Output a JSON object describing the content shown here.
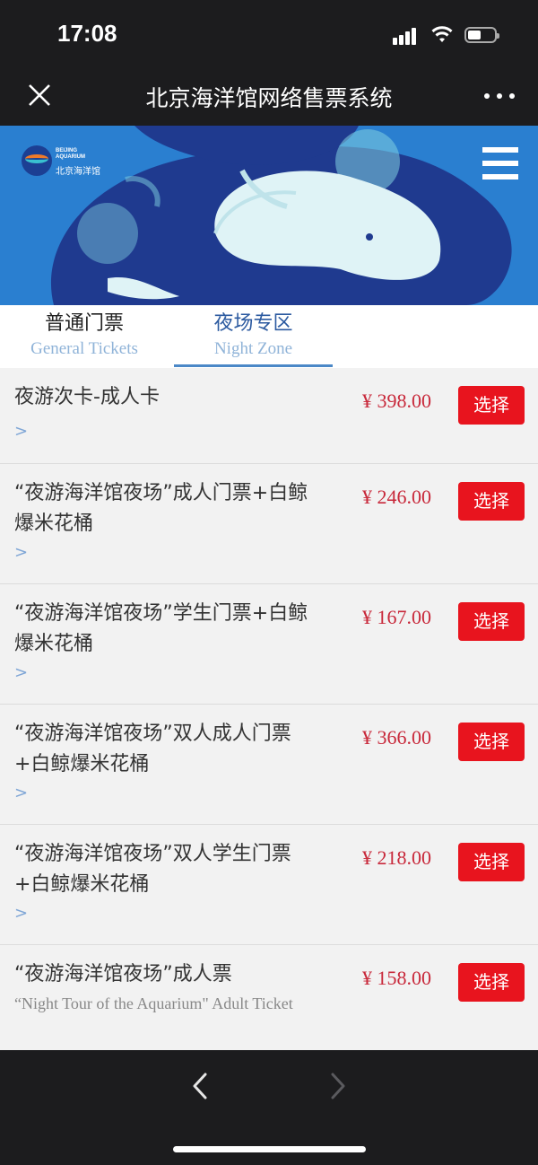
{
  "status_bar": {
    "time": "17:08"
  },
  "nav": {
    "title": "北京海洋馆网络售票系统"
  },
  "banner": {
    "logo_en_line1": "BEIJING",
    "logo_en_line2": "AQUARIUM",
    "logo_cn": "北京海洋馆"
  },
  "tabs": [
    {
      "cn": "普通门票",
      "en": "General Tickets",
      "active": false
    },
    {
      "cn": "夜场专区",
      "en": "Night Zone",
      "active": true
    }
  ],
  "tickets": [
    {
      "name": "夜游次卡-成人卡",
      "price": "¥ 398.00",
      "button": "选择",
      "arrow": ">"
    },
    {
      "name": "“夜游海洋馆夜场”成人门票+白鲸爆米花桶",
      "price": "¥ 246.00",
      "button": "选择",
      "arrow": ">"
    },
    {
      "name": "“夜游海洋馆夜场”学生门票+白鲸爆米花桶",
      "price": "¥ 167.00",
      "button": "选择",
      "arrow": ">"
    },
    {
      "name": "“夜游海洋馆夜场”双人成人门票+白鲸爆米花桶",
      "price": "¥ 366.00",
      "button": "选择",
      "arrow": ">"
    },
    {
      "name": "“夜游海洋馆夜场”双人学生门票+白鲸爆米花桶",
      "price": "¥ 218.00",
      "button": "选择",
      "arrow": ">"
    },
    {
      "name": "“夜游海洋馆夜场”成人票",
      "subtitle": "“Night Tour of the Aquarium\" Adult Ticket",
      "price": "¥ 158.00",
      "button": "选择"
    }
  ],
  "colors": {
    "accent_red": "#e8141e",
    "price_red": "#c8283a",
    "tab_blue": "#2c5aa0",
    "banner_blue": "#2a7fd0"
  }
}
